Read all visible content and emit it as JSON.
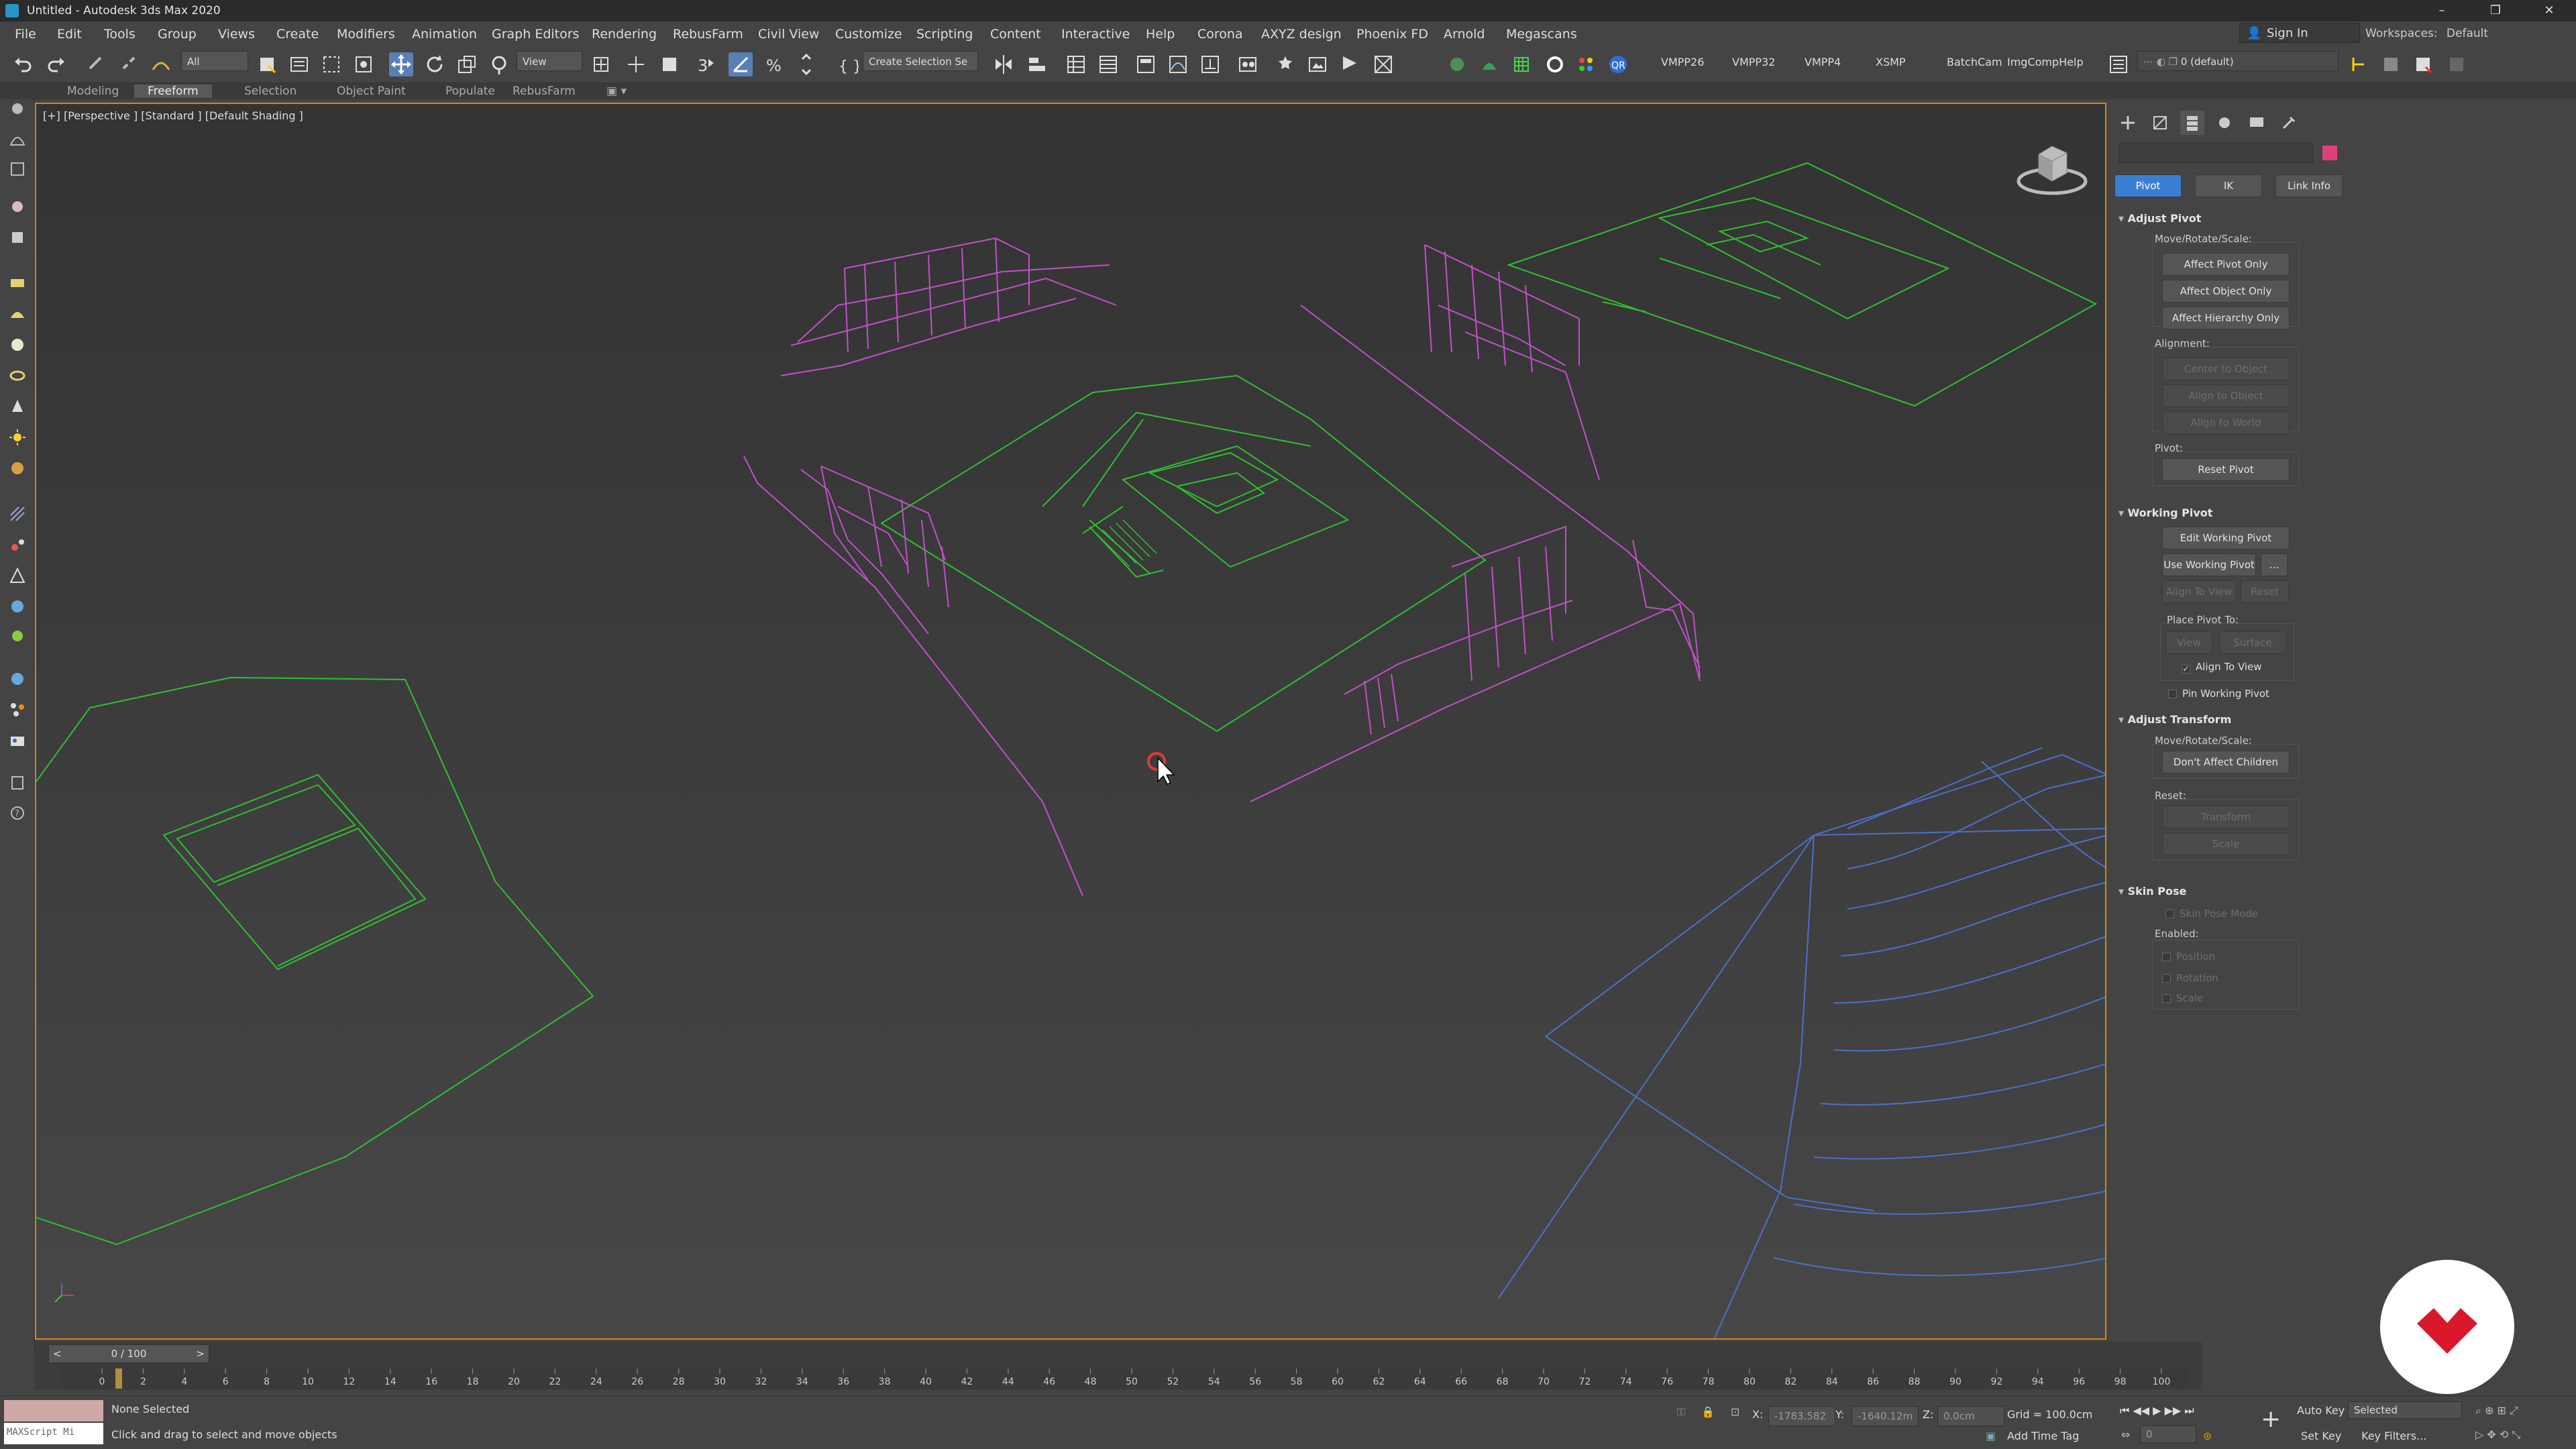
{
  "window": {
    "title": "Untitled - Autodesk 3ds Max 2020",
    "minimize": "–",
    "restore": "❐",
    "close": "✕"
  },
  "menu": [
    "File",
    "Edit",
    "Tools",
    "Group",
    "Views",
    "Create",
    "Modifiers",
    "Animation",
    "Graph Editors",
    "Rendering",
    "RebusFarm",
    "Civil View",
    "Customize",
    "Scripting",
    "Content",
    "Interactive",
    "Help",
    "Corona",
    "AXYZ design",
    "Phoenix FD",
    "Arnold",
    "Megascans"
  ],
  "account": {
    "sign_in": "Sign In",
    "workspaces_label": "Workspaces:",
    "workspace": "Default"
  },
  "toolbar": {
    "filter": "All",
    "ref_coord": "View",
    "selection_set": "Create Selection Se",
    "plugins": [
      "VMPP26",
      "VMPP32",
      "VMPP4",
      "XSMP",
      "BatchCam",
      "ImgCompHelp"
    ],
    "layer": "0 (default)"
  },
  "ribbon_tabs": [
    "Modeling",
    "Freeform",
    "Selection",
    "Object Paint",
    "Populate",
    "RebusFarm"
  ],
  "ribbon_active": "Freeform",
  "viewport": {
    "label": "[+] [Perspective ] [Standard ] [Default Shading ]"
  },
  "command_panel": {
    "tabs": [
      "Pivot",
      "IK",
      "Link Info"
    ],
    "active_tab": "Pivot",
    "adjust_pivot": {
      "title": "Adjust Pivot",
      "move_label": "Move/Rotate/Scale:",
      "buttons": [
        "Affect Pivot Only",
        "Affect Object Only",
        "Affect Hierarchy Only"
      ],
      "alignment_label": "Alignment:",
      "align_buttons": [
        "Center to Object",
        "Align to Object",
        "Align to World"
      ],
      "pivot_label": "Pivot:",
      "reset_pivot": "Reset Pivot"
    },
    "working_pivot": {
      "title": "Working Pivot",
      "edit": "Edit Working Pivot",
      "use": "Use Working Pivot",
      "more": "...",
      "align_to_view": "Align To View",
      "reset": "Reset",
      "place_label": "Place Pivot To:",
      "view": "View",
      "surface": "Surface",
      "align_check": "Align To View",
      "pin": "Pin Working Pivot"
    },
    "adjust_transform": {
      "title": "Adjust Transform",
      "move_label": "Move/Rotate/Scale:",
      "dont_affect": "Don't Affect Children",
      "reset_label": "Reset:",
      "transform": "Transform",
      "scale": "Scale"
    },
    "skin_pose": {
      "title": "Skin Pose",
      "mode": "Skin Pose Mode",
      "enabled_label": "Enabled:",
      "position": "Position",
      "rotation": "Rotation",
      "scale": "Scale"
    }
  },
  "timeline": {
    "frame_display": "0 / 100",
    "prev": "<",
    "next": ">",
    "ticks": [
      "0",
      "2",
      "4",
      "6",
      "8",
      "10",
      "12",
      "14",
      "16",
      "18",
      "20",
      "22",
      "24",
      "26",
      "28",
      "30",
      "32",
      "34",
      "36",
      "38",
      "40",
      "42",
      "44",
      "46",
      "48",
      "50",
      "52",
      "54",
      "56",
      "58",
      "60",
      "62",
      "64",
      "66",
      "68",
      "70",
      "72",
      "74",
      "76",
      "78",
      "80",
      "82",
      "84",
      "86",
      "88",
      "90",
      "92",
      "94",
      "96",
      "98",
      "100"
    ]
  },
  "status": {
    "maxscript": "MAXScript Mi",
    "selection": "None Selected",
    "prompt": "Click and drag to select and move objects",
    "x_label": "X:",
    "x_value": "-1783.582",
    "y_label": "Y:",
    "y_value": "-1640.12m",
    "z_label": "Z:",
    "z_value": "0.0cm",
    "grid": "Grid = 100.0cm",
    "add_time_tag": "Add Time Tag",
    "auto_key": "Auto Key",
    "set_key": "Set Key",
    "key_mode": "Selected",
    "key_filters": "Key Filters...",
    "current_frame": "0"
  },
  "colors": {
    "viewport_border": "#d08a1a",
    "wire_green": "#2fbf2f",
    "wire_magenta": "#c050c8",
    "wire_blue": "#4c6fc8",
    "pivot_tab": "#3a7fd5",
    "swatch": "#e0407a"
  }
}
